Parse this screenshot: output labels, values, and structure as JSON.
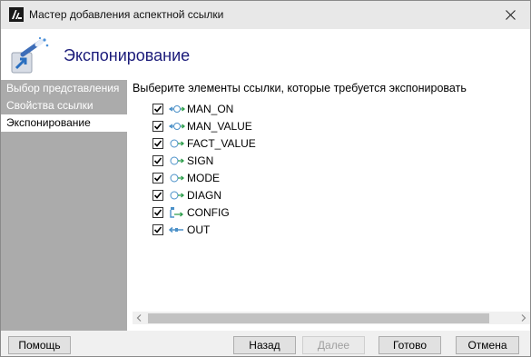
{
  "window": {
    "title": "Мастер добавления аспектной ссылки",
    "app_icon": "app-logo-icon",
    "close_icon": "close-icon"
  },
  "header": {
    "title": "Экспонирование",
    "icon": "wizard-wand-icon"
  },
  "sidebar": {
    "items": [
      {
        "label": "Выбор представления",
        "active": false
      },
      {
        "label": "Свойства ссылки",
        "active": false
      },
      {
        "label": "Экспонирование",
        "active": true
      }
    ]
  },
  "main": {
    "instruction": "Выберите элементы ссылки, которые требуется экспонировать",
    "items": [
      {
        "label": "MAN_ON",
        "checked": true,
        "icon": "bidirectional-connector-icon"
      },
      {
        "label": "MAN_VALUE",
        "checked": true,
        "icon": "bidirectional-connector-icon"
      },
      {
        "label": "FACT_VALUE",
        "checked": true,
        "icon": "input-connector-icon"
      },
      {
        "label": "SIGN",
        "checked": true,
        "icon": "input-connector-icon"
      },
      {
        "label": "MODE",
        "checked": true,
        "icon": "input-connector-icon"
      },
      {
        "label": "DIAGN",
        "checked": true,
        "icon": "input-connector-icon"
      },
      {
        "label": "CONFIG",
        "checked": true,
        "icon": "config-connector-icon"
      },
      {
        "label": "OUT",
        "checked": true,
        "icon": "output-connector-icon"
      }
    ]
  },
  "footer": {
    "help": "Помощь",
    "back": "Назад",
    "next": "Далее",
    "finish": "Готово",
    "cancel": "Отмена"
  },
  "colors": {
    "sidebar_bg": "#ababab",
    "header_title": "#1b1b7a",
    "connector_blue": "#4a90c8",
    "connector_green": "#2e9e4c"
  }
}
